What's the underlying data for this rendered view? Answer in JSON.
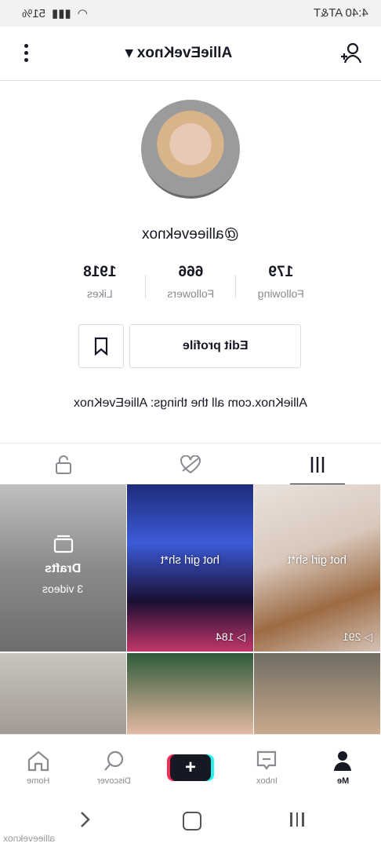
{
  "status_bar": {
    "time": "4:40 AT&T",
    "battery": "51%"
  },
  "header": {
    "title": "AllieEveKnox ▾"
  },
  "profile": {
    "handle": "@allieeveknox",
    "stats": [
      {
        "value": "179",
        "label": "Following"
      },
      {
        "value": "666",
        "label": "Followers"
      },
      {
        "value": "1918",
        "label": "Likes"
      }
    ],
    "edit_label": "Edit profile",
    "bio": "AllieKnox.com all the things: AllieEveKnox"
  },
  "grid": [
    {
      "overlay": "",
      "drafts_title": "Drafts",
      "drafts_count": "3 videos",
      "views": ""
    },
    {
      "overlay": "hot girl sh*t",
      "views": "184"
    },
    {
      "overlay": "hot girl sh*t",
      "views": "291"
    }
  ],
  "nav": [
    {
      "label": "Home"
    },
    {
      "label": "Discover"
    },
    {
      "label": "+"
    },
    {
      "label": "Inbox"
    },
    {
      "label": "Me"
    }
  ],
  "watermark": "allieeveknox"
}
